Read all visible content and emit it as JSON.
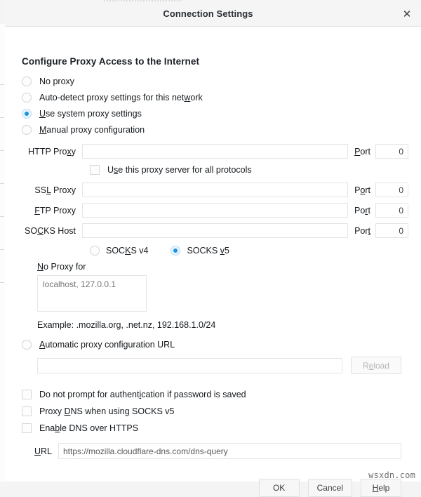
{
  "window": {
    "title": "Connection Settings",
    "close_icon": "close-icon",
    "close_glyph": "✕"
  },
  "section": {
    "heading": "Configure Proxy Access to the Internet"
  },
  "proxy_mode": {
    "selected": "system",
    "options": [
      {
        "id": "none",
        "label": "No proxy",
        "accesskey": "",
        "checked": false
      },
      {
        "id": "auto",
        "label": "Auto-detect proxy settings for this network",
        "accesskey": "w",
        "checked": false
      },
      {
        "id": "system",
        "label": "Use system proxy settings",
        "accesskey": "U",
        "checked": true
      },
      {
        "id": "manual",
        "label": "Manual proxy configuration",
        "accesskey": "M",
        "checked": false
      }
    ]
  },
  "manual": {
    "fields": [
      {
        "id": "http",
        "label": "HTTP Proxy",
        "label_key": "x",
        "value": "",
        "port_label": "Port",
        "port_key": "P",
        "port_value": "0"
      },
      {
        "id": "ssl",
        "label": "SSL Proxy",
        "label_key": "L",
        "value": "",
        "port_label": "Port",
        "port_key": "o",
        "port_value": "0"
      },
      {
        "id": "ftp",
        "label": "FTP Proxy",
        "label_key": "F",
        "value": "",
        "port_label": "Port",
        "port_key": "r",
        "port_value": "0"
      },
      {
        "id": "socks",
        "label": "SOCKS Host",
        "label_key": "C",
        "value": "",
        "port_label": "Port",
        "port_key": "t",
        "port_value": "0"
      }
    ],
    "use_all_protocols": {
      "label": "Use this proxy server for all protocols",
      "accesskey": "s",
      "checked": false
    },
    "socks_version": {
      "selected": "v5",
      "options": [
        {
          "id": "v4",
          "label": "SOCKS v4",
          "accesskey": "K",
          "checked": false
        },
        {
          "id": "v5",
          "label": "SOCKS v5",
          "accesskey": "v",
          "checked": true
        }
      ]
    },
    "no_proxy": {
      "label": "No Proxy for",
      "accesskey": "N",
      "value": "",
      "placeholder": "localhost, 127.0.0.1",
      "example": "Example: .mozilla.org, .net.nz, 192.168.1.0/24"
    }
  },
  "pac": {
    "radio": {
      "id": "pac",
      "label": "Automatic proxy configuration URL",
      "accesskey": "A",
      "checked": false
    },
    "url_value": "",
    "reload_button": {
      "label": "Reload",
      "accesskey": "e",
      "disabled": true
    }
  },
  "options": [
    {
      "id": "no-prompt",
      "label": "Do not prompt for authentication if password is saved",
      "accesskey": "i",
      "checked": false
    },
    {
      "id": "proxy-dns",
      "label": "Proxy DNS when using SOCKS v5",
      "accesskey": "D",
      "checked": false
    },
    {
      "id": "doh",
      "label": "Enable DNS over HTTPS",
      "accesskey": "b",
      "checked": false
    }
  ],
  "doh": {
    "url_label": "URL",
    "url_accesskey": "U",
    "url_value": "https://mozilla.cloudflare-dns.com/dns-query"
  },
  "footer": {
    "ok": {
      "label": "OK",
      "accesskey": ""
    },
    "cancel": {
      "label": "Cancel",
      "accesskey": ""
    },
    "help": {
      "label": "Help",
      "accesskey": "H"
    }
  },
  "watermark": "wsxdn.com",
  "colors": {
    "accent": "#1a94e0",
    "accent_ring": "#b8ddf5",
    "accent_fill": "#eaf4fc",
    "text": "#15191d",
    "placeholder": "#c6c8cb",
    "titlebar_bg": "#f5f5f5",
    "border": "#e4e4e6"
  }
}
